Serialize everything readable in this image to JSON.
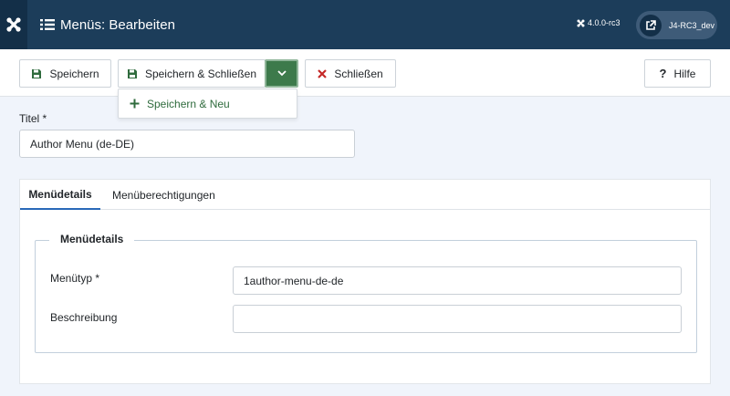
{
  "header": {
    "title": "Menüs: Bearbeiten",
    "version": "4.0.0-rc3",
    "site_name": "J4-RC3_dev"
  },
  "toolbar": {
    "save_label": "Speichern",
    "save_close_label": "Speichern & Schließen",
    "close_label": "Schließen",
    "help_label": "Hilfe",
    "dropdown": {
      "save_new_label": "Speichern & Neu"
    }
  },
  "form": {
    "title_label": "Titel *",
    "title_value": "Author Menu (de-DE)",
    "tabs": [
      {
        "label": "Menüdetails",
        "active": true
      },
      {
        "label": "Menüberechtigungen",
        "active": false
      }
    ],
    "fieldset_legend": "Menüdetails",
    "menu_type_label": "Menütyp *",
    "menu_type_value": "1author-menu-de-de",
    "description_label": "Beschreibung",
    "description_value": ""
  },
  "colors": {
    "header_bg": "#1c3d5a",
    "success": "#3d7a4b",
    "danger": "#c52827",
    "tab_active": "#2a69b8"
  },
  "icons": [
    "joomla-icon",
    "list-icon",
    "external-link-icon",
    "save-icon",
    "chevron-down-icon",
    "plus-icon",
    "close-icon",
    "question-icon"
  ]
}
